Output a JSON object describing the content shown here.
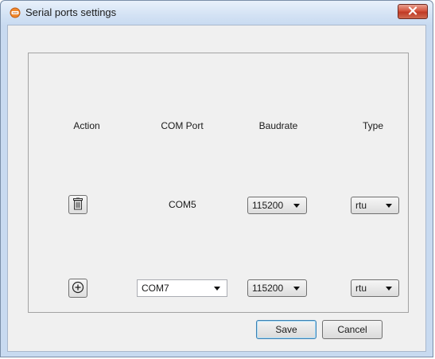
{
  "window": {
    "title": "Serial ports settings",
    "app_icon": "serial-port-icon",
    "close_icon": "close-icon"
  },
  "table": {
    "headers": [
      "Action",
      "COM Port",
      "Baudrate",
      "Type"
    ],
    "rows": [
      {
        "action_icon": "trash-icon",
        "port": "COM5",
        "baudrate": "115200",
        "type": "rtu"
      },
      {
        "action_icon": "add-icon",
        "port": "COM7",
        "baudrate": "115200",
        "type": "rtu"
      }
    ]
  },
  "buttons": {
    "save": "Save",
    "cancel": "Cancel"
  },
  "colors": {
    "close_button": "#c8402b",
    "title_bar": "#d3e2f4",
    "dialog_bg": "#f0f0f0"
  }
}
